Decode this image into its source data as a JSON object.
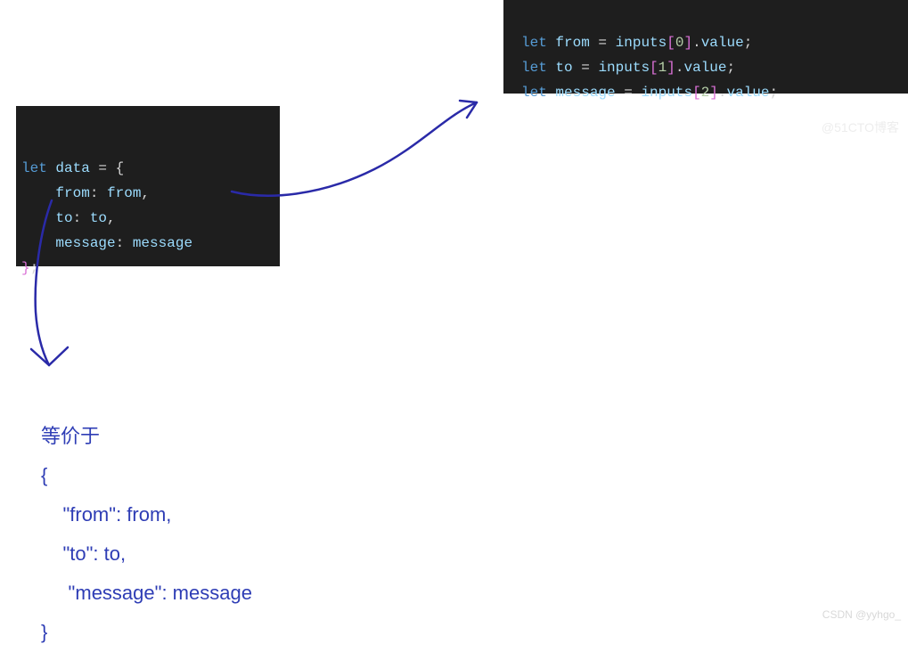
{
  "code_top": {
    "line1": {
      "kw": "let",
      "var": "from",
      "eq": " = ",
      "src": "inputs",
      "lb": "[",
      "idx": "0",
      "rb": "]",
      "dot": ".",
      "prop": "value",
      "semi": ";"
    },
    "line2": {
      "kw": "let",
      "var": "to",
      "eq": " = ",
      "src": "inputs",
      "lb": "[",
      "idx": "1",
      "rb": "]",
      "dot": ".",
      "prop": "value",
      "semi": ";"
    },
    "line3": {
      "kw": "let",
      "var": "message",
      "eq": " = ",
      "src": "inputs",
      "lb": "[",
      "idx": "2",
      "rb": "]",
      "dot": ".",
      "prop": "value",
      "semi": ";"
    }
  },
  "code_left": {
    "line1": {
      "kw": "let",
      "var": "data",
      "eq": " = ",
      "brace": "{"
    },
    "line2": {
      "indent": "    ",
      "key": "from",
      "colon": ": ",
      "val": "from",
      "comma": ","
    },
    "line3": {
      "indent": "    ",
      "key": "to",
      "colon": ": ",
      "val": "to",
      "comma": ","
    },
    "line4": {
      "indent": "    ",
      "key": "message",
      "colon": ": ",
      "val": "message"
    },
    "line5": {
      "brace": "}",
      "semi": ";"
    }
  },
  "equiv": {
    "title": "等价于",
    "open": "{",
    "l1": "    \"from\": from,",
    "l2": "    \"to\": to,",
    "l3": "     \"message\": message",
    "close": "}"
  },
  "watermark": "CSDN @yyhgo_",
  "watermark2": "@51CTO博客"
}
